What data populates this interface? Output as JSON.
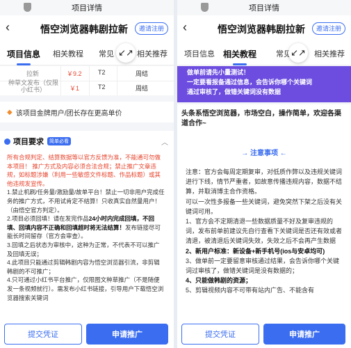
{
  "status_title": "项目详情",
  "nav": {
    "back": "‹",
    "title": "悟空浏览器韩剧拉新",
    "invite": "邀请注册"
  },
  "tabs": [
    "项目信息",
    "相关教程",
    "常见问题",
    "相关推荐"
  ],
  "tab_partial": "常见",
  "collapse_icon": "↙↗",
  "left": {
    "price_rows": [
      {
        "name": "拉新",
        "price": "￥9.2",
        "tier": "T2",
        "cycle": "周结"
      },
      {
        "name": "种草文发布（仅限小红书）",
        "price": "￥1",
        "tier": "T2",
        "cycle": "周结"
      }
    ],
    "notice": "该项目金牌用户/团长存在更高单价",
    "req_title": "项目要求",
    "req_tag": "简单必看",
    "req_red": "所有合规判定、结算数据等以官方反馈为准，不能通可勿做本项目！ 推广方式及内容必须合法合规；禁止推广文章违规，如标题涉嫌（利用一些敏感文件标题、作品标题）或其他违规发宣传。",
    "req_lines": [
      "1.禁止机刷/任务量/激励量/故单平台！禁止一切非用户完成任务的推广方式，不用试肯定不结算！只收真实自然量用户！（由悟空官方判定）。",
      "2.项目必须回填！请在发完作品",
      "24小时内完成回填，不回填、回填内容不正确和回填超时将无法结算！",
      "发布链接尽可能长时间留存（官方会审查）。",
      "3.回填之后状态为审核中，这种为正常，不代表不可以推广及回填无误；",
      "4.此项目只能通过剪辑韩剧内容为悟空浏览器引流，非剪辑韩剧的不可推广；",
      "4.只可通过小红书平台推广，仅限图文种草推广（不是随便发一条视频就行）。需发布小红书链接，引导用户下载悟空浏览器搜索关键词"
    ]
  },
  "right": {
    "purple_lines": [
      "做单前请先小量测试！",
      "一定要看报备通过信息，会告诉你哪个关键词",
      "通过审核了，做错关键词没有数据"
    ],
    "promo": "头条系悟空浏览器，市场空白，操作简单，欢迎各渠道合作~",
    "section_title": "→ 注意事项 ←",
    "notes": [
      "注意：官方会每周定期复审，对低质作弊以及违规关键词进行下线，情节严重者，如故意传播违规内容，数据不结算，并取消博主合作资格。",
      "可以一次性多报备一些关键词，避免突然下架之后没有关键词可用。",
      "1、官方会不定期清退一些数据质量不好及复审违规的词，发布前单前建议先自行查看下关键词是否还有效或者清退，被清退后关键词失效，失效之后不会再产生数据",
      "2、新用户标准：新设备+新手机号(ios与安卓均可)",
      "3、做单前一定要留意审核通过结果，会告诉你哪个关键词过审核了，做错关键词是没有数据的；",
      "4、只能做韩剧的资源；",
      "5、剪辑视频内容不可带有站内广告、不能含有"
    ]
  },
  "buttons": {
    "submit": "提交凭证",
    "apply": "申请推广"
  },
  "colors": {
    "accent": "#3a6df0",
    "price_red": "#e6452e",
    "purple": "#6c4ddf"
  }
}
